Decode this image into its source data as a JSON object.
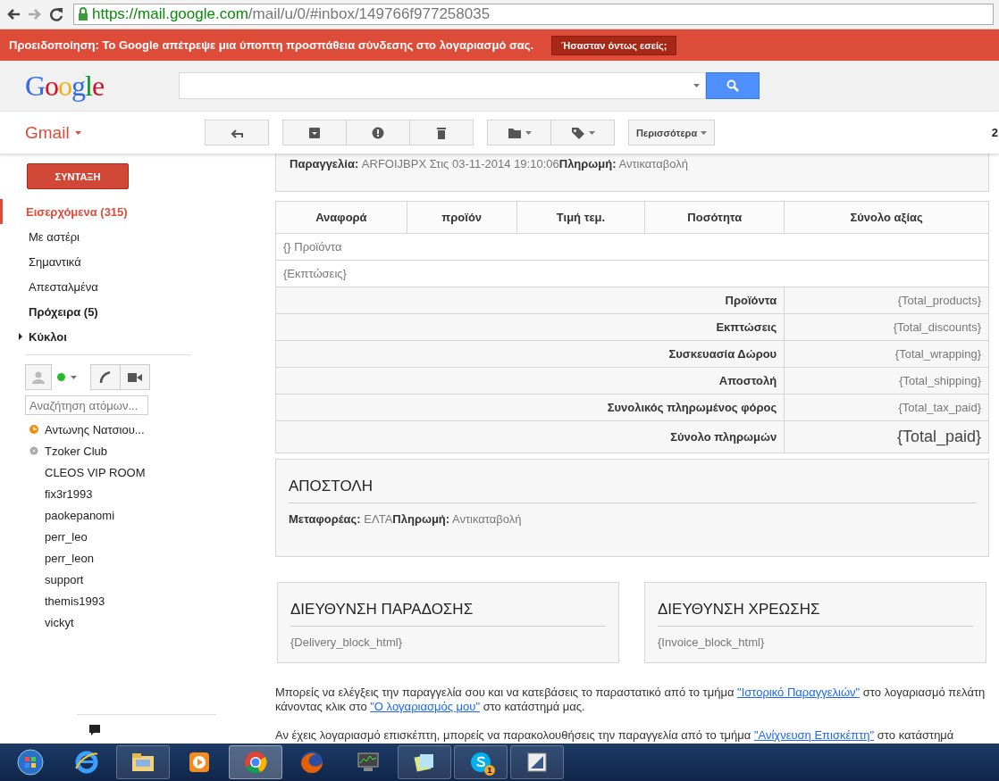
{
  "browser": {
    "url_host": "https://mail.google.com",
    "url_path": "/mail/u/0/#inbox/149766f977258035"
  },
  "warning": {
    "text": "Προειδοποίηση: Το Google απέτρεψε μια ύποπτη προσπάθεια σύνδεσης στο λογαριασμό σας.",
    "button": "Ήσασταν όντως εσείς;"
  },
  "logo": "Google",
  "app_menu": "Gmail",
  "toolbar": {
    "more": "Περισσότερα",
    "page_count": "2"
  },
  "compose": "ΣΥΝΤΑΞΗ",
  "nav": [
    {
      "label": "Εισερχόμενα (315)",
      "selected": true,
      "bold": false,
      "kind": "item"
    },
    {
      "label": "Με αστέρι",
      "selected": false,
      "bold": false,
      "kind": "item"
    },
    {
      "label": "Σημαντικά",
      "selected": false,
      "bold": false,
      "kind": "item"
    },
    {
      "label": "Απεσταλμένα",
      "selected": false,
      "bold": false,
      "kind": "item"
    },
    {
      "label": "Πρόχειρα (5)",
      "selected": false,
      "bold": true,
      "kind": "item"
    },
    {
      "label": "Κύκλοι",
      "selected": false,
      "bold": true,
      "kind": "group",
      "expanded": false
    }
  ],
  "chat": {
    "status_dot": {
      "color": "#2eb82e"
    },
    "search_placeholder": "Αναζήτηση ατόμων...",
    "contacts": [
      {
        "name": "Αντωνης Νατσιου...",
        "idle": true,
        "offline": false
      },
      {
        "name": "Tzoker Club",
        "idle": false,
        "offline": true
      },
      {
        "name": "CLEOS VIP ROOM",
        "idle": false,
        "offline": false
      },
      {
        "name": "fix3r1993",
        "idle": false,
        "offline": false
      },
      {
        "name": "paokepanomi",
        "idle": false,
        "offline": false
      },
      {
        "name": "perr_leo",
        "idle": false,
        "offline": false
      },
      {
        "name": "perr_leon",
        "idle": false,
        "offline": false
      },
      {
        "name": "support",
        "idle": false,
        "offline": false
      },
      {
        "name": "themis1993",
        "idle": false,
        "offline": false
      },
      {
        "name": "vickyt",
        "idle": false,
        "offline": false
      }
    ]
  },
  "order": {
    "line": "**Παραγγελία:** ARFOIJBPX Στις 03-11-2014 19:10:06**Πληρωμή:** Αντικαταβολή"
  },
  "table": {
    "columns": [
      "Αναφορά",
      "προϊόν",
      "Τιμή τεμ.",
      "Ποσότητα",
      "Σύνολο αξίας"
    ],
    "rows": [
      "{} Προϊόντα",
      "{Εκπτώσεις}"
    ],
    "totals": [
      {
        "label": "Προϊόντα",
        "value": "{Total_products}",
        "emphasis": false
      },
      {
        "label": "Εκπτώσεις",
        "value": "{Total_discounts}",
        "emphasis": false
      },
      {
        "label": "Συσκευασία Δώρου",
        "value": "{Total_wrapping}",
        "emphasis": false
      },
      {
        "label": "Αποστολή",
        "value": "{Total_shipping}",
        "emphasis": false
      },
      {
        "label": "Συνολικός πληρωμένος φόρος",
        "value": "{Total_tax_paid}",
        "emphasis": false
      },
      {
        "label": "Σύνολο πληρωμών",
        "value": "{Total_paid}",
        "emphasis": true
      }
    ]
  },
  "shipping": {
    "title": "ΑΠΟΣΤΟΛΗ",
    "line": "**Μεταφορέας:** ΕΛΤΑ**Πληρωμή:** Αντικαταβολή"
  },
  "addresses": [
    {
      "title": "ΔΙΕΥΘΥΝΣΗ ΠΑΡΑΔΟΣΗΣ",
      "body": "{Delivery_block_html}"
    },
    {
      "title": "ΔΙΕΥΘΥΝΣΗ ΧΡΕΩΣΗΣ",
      "body": "{Invoice_block_html}"
    }
  ],
  "paragraphs": [
    [
      {
        "text": "Μπορείς να ελέγξεις την παραγγελία σου και να κατεβάσεις το παραστατικό από το τμήμα "
      },
      {
        "link": "\"Ιστορικό Παραγγελιών\""
      },
      {
        "text": " στο λογαριασμό πελάτη κάνοντας κλικ στο "
      },
      {
        "link": "\"Ο λογαριασμός μου\""
      },
      {
        "text": " στο κατάστημά μας."
      }
    ],
    [
      {
        "text": "Αν έχεις λογαριασμό επισκέπτη, μπορείς να παρακολουθήσεις την παραγγελία από το τμήμα "
      },
      {
        "link": "\"Ανίχνευση Επισκέπτη\""
      },
      {
        "text": " στο κατάστημά"
      }
    ]
  ],
  "taskbar": {
    "skype_badge": "1"
  }
}
